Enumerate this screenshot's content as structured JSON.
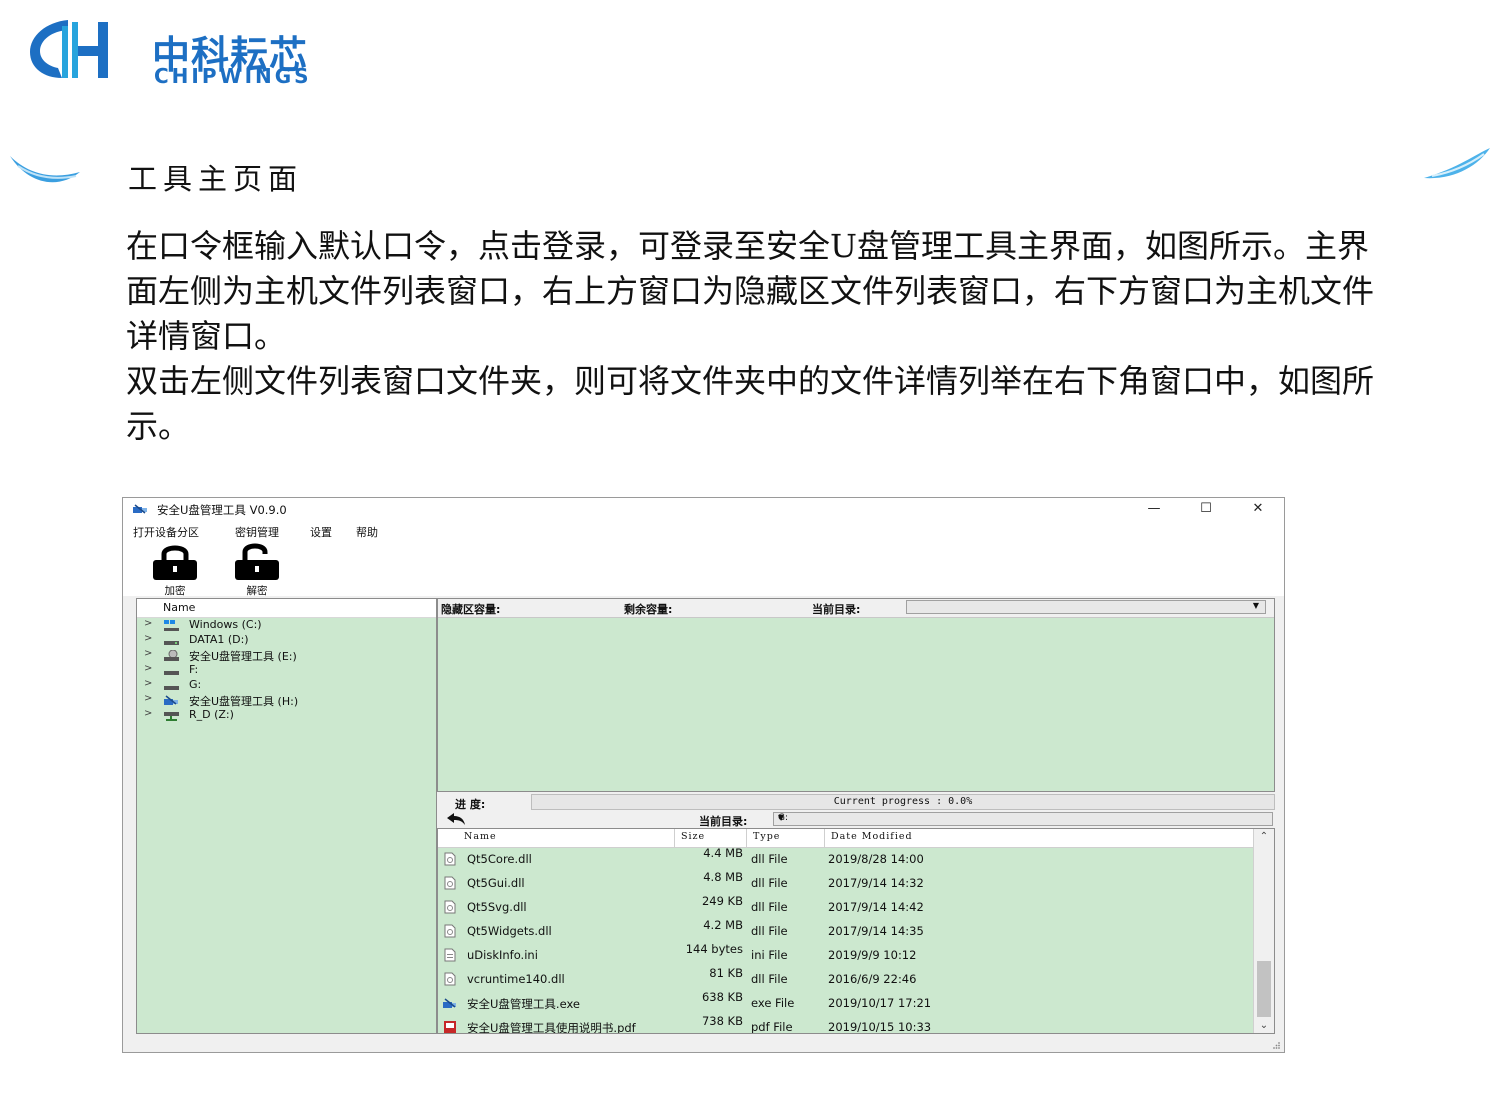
{
  "logo": {
    "cn": "中科耘芯",
    "en": "CHIPWINGS"
  },
  "slide": {
    "heading": "工具主页面",
    "paragraph1": "在口令框输入默认口令，点击登录，可登录至安全U盘管理工具主界面，如图所示。主界面左侧为主机文件列表窗口，右上方窗口为隐藏区文件列表窗口，右下方窗口为主机文件详情窗口。",
    "paragraph2": "双击左侧文件列表窗口文件夹，则可将文件夹中的文件详情列举在右下角窗口中，如图所示。"
  },
  "app": {
    "title": "安全U盘管理工具 V0.9.0",
    "buttons": {
      "minimize": "—",
      "maximize": "☐",
      "close": "✕"
    },
    "menu": [
      "打开设备分区",
      "密钥管理",
      "设置",
      "帮助"
    ],
    "toolbar": {
      "encrypt": "加密",
      "decrypt": "解密"
    },
    "tree": {
      "header": "Name",
      "items": [
        {
          "label": "Windows (C:)"
        },
        {
          "label": "DATA1 (D:)"
        },
        {
          "label": "安全U盘管理工具 (E:)"
        },
        {
          "label": "F:"
        },
        {
          "label": "G:"
        },
        {
          "label": "安全U盘管理工具 (H:)"
        },
        {
          "label": "R_D (Z:)"
        }
      ]
    },
    "hidden_area": {
      "capacity_label": "隐藏区容量:",
      "remaining_label": "剩余容量:",
      "current_dir_label": "当前目录:"
    },
    "progress": {
      "label": "进  度:",
      "text": "Current progress : 0.0%",
      "value": 0.0
    },
    "host": {
      "current_dir_label": "当前目录:",
      "current_dir": "G:"
    },
    "file_table": {
      "columns": [
        "Name",
        "Size",
        "Type",
        "Date Modified"
      ],
      "rows": [
        {
          "name": "Qt5Core.dll",
          "size": "4.4 MB",
          "type": "dll File",
          "date": "2019/8/28 14:00",
          "icon": "dll-file-icon"
        },
        {
          "name": "Qt5Gui.dll",
          "size": "4.8 MB",
          "type": "dll File",
          "date": "2017/9/14 14:32",
          "icon": "dll-file-icon"
        },
        {
          "name": "Qt5Svg.dll",
          "size": "249 KB",
          "type": "dll File",
          "date": "2017/9/14 14:42",
          "icon": "dll-file-icon"
        },
        {
          "name": "Qt5Widgets.dll",
          "size": "4.2 MB",
          "type": "dll File",
          "date": "2017/9/14 14:35",
          "icon": "dll-file-icon"
        },
        {
          "name": "uDiskInfo.ini",
          "size": "144 bytes",
          "type": "ini File",
          "date": "2019/9/9 10:12",
          "icon": "ini-file-icon"
        },
        {
          "name": "vcruntime140.dll",
          "size": "81 KB",
          "type": "dll File",
          "date": "2016/6/9 22:46",
          "icon": "dll-file-icon"
        },
        {
          "name": "安全U盘管理工具.exe",
          "size": "638 KB",
          "type": "exe File",
          "date": "2019/10/17 17:21",
          "icon": "app-exe-icon"
        },
        {
          "name": "安全U盘管理工具使用说明书.pdf",
          "size": "738 KB",
          "type": "pdf File",
          "date": "2019/10/15 10:33",
          "icon": "pdf-file-icon"
        }
      ]
    }
  },
  "colors": {
    "brand": "#1d6fc3",
    "pane_green": "#cce8cf",
    "progress": "#5cb85c"
  }
}
